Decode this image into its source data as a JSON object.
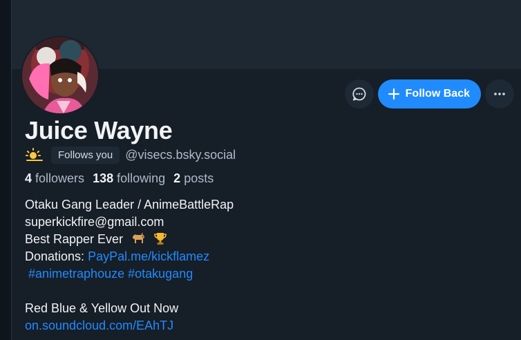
{
  "profile": {
    "display_name": "Juice Wayne",
    "status_emoji": "sun-behind-cloud",
    "follows_you_label": "Follows you",
    "handle": "@visecs.bsky.social"
  },
  "stats": {
    "followers_count": "4",
    "followers_label": "followers",
    "following_count": "138",
    "following_label": "following",
    "posts_count": "2",
    "posts_label": "posts"
  },
  "actions": {
    "follow_back_label": "Follow Back",
    "message_icon": "chat-bubble-icon",
    "more_icon": "ellipsis-icon"
  },
  "bio": {
    "line1": "Otaku Gang Leader / AnimeBattleRap",
    "line2": "superkickfire@gmail.com",
    "line3": "Best Rapper Ever",
    "line4_prefix": "Donations: ",
    "line4_link": "PayPal.me/kickflamez",
    "hashtag1": "#animetraphouze",
    "hashtag2": "#otakugang",
    "line6": "Red Blue & Yellow Out Now",
    "line7_link": "on.soundcloud.com/EAhTJ"
  },
  "colors": {
    "accent": "#208bfe",
    "background": "#161e27",
    "banner": "#1e2833",
    "text_primary": "#f1f3f5",
    "text_secondary": "#aebbc9"
  }
}
